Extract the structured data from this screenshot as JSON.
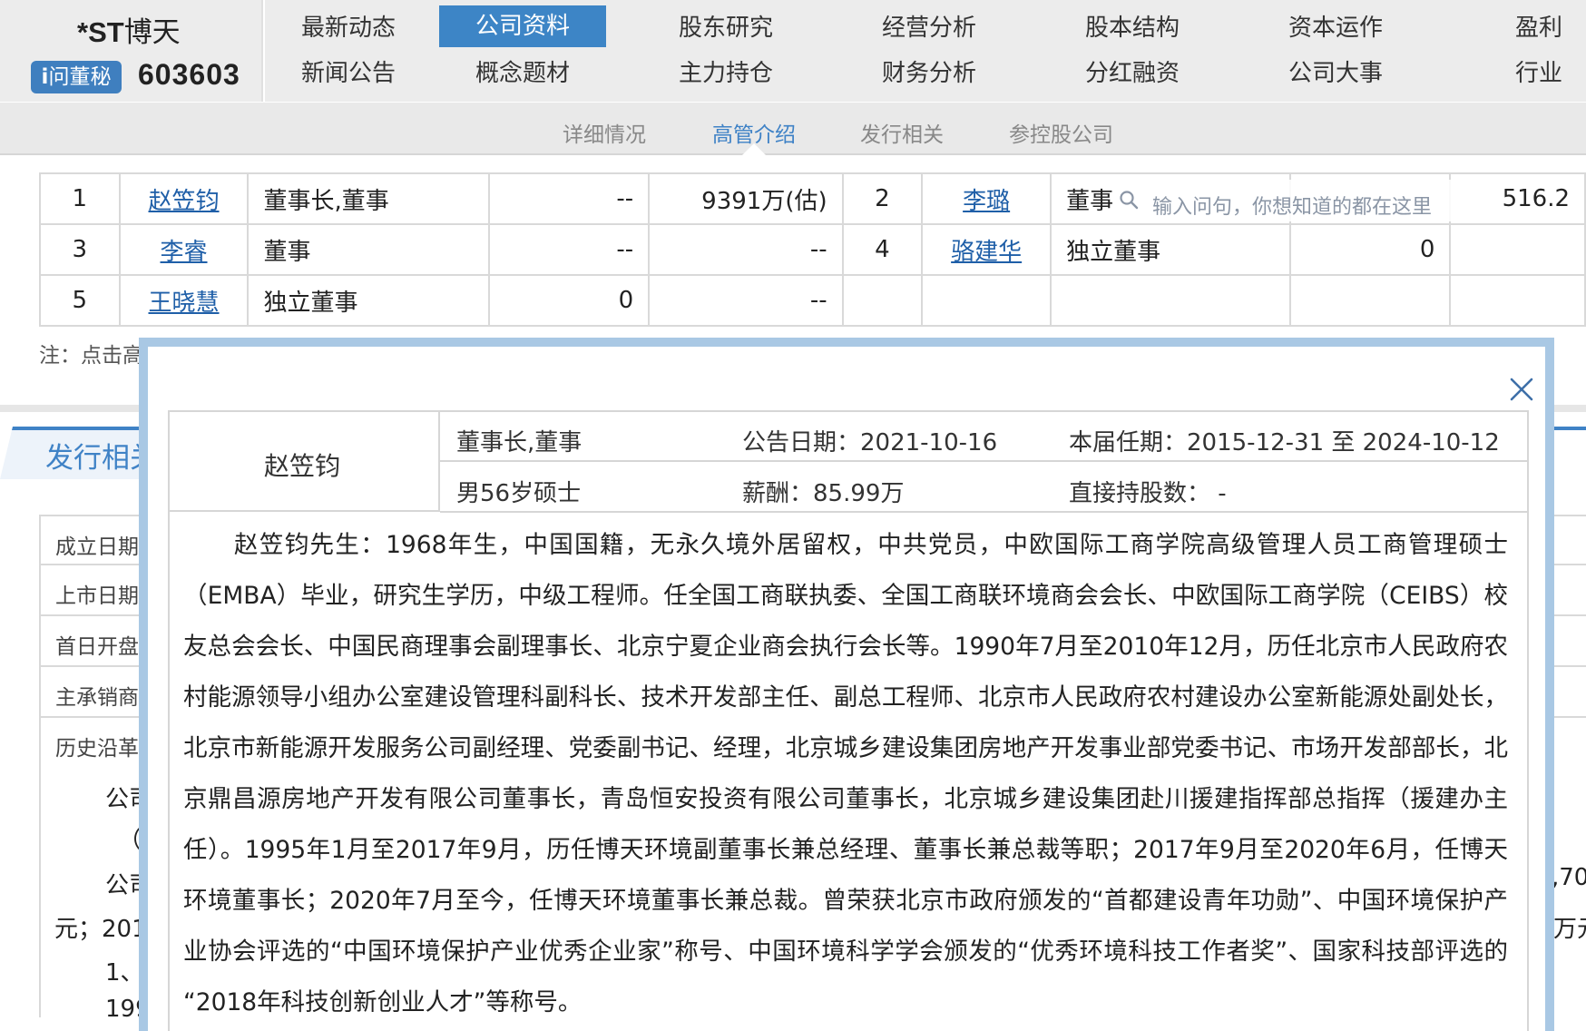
{
  "stock": {
    "prefix": "*ST",
    "name": "博天",
    "ask_label": "问董秘",
    "ask_prefix": "i",
    "code": "603603"
  },
  "nav": {
    "row1": [
      "最新动态",
      "公司资料",
      "股东研究",
      "经营分析",
      "股本结构",
      "资本运作",
      "盈利"
    ],
    "row2": [
      "新闻公告",
      "概念题材",
      "主力持仓",
      "财务分析",
      "分红融资",
      "公司大事",
      "行业"
    ],
    "active": "公司资料"
  },
  "subnav": {
    "items": [
      "详细情况",
      "高管介绍",
      "发行相关",
      "参控股公司"
    ],
    "active": "高管介绍"
  },
  "exec_table": {
    "rows": [
      {
        "n1": "1",
        "name1": "赵笠钧",
        "title1": "董事长,董事",
        "hold1": "--",
        "pay1": "9391万(估)",
        "n2": "2",
        "name2": "李璐",
        "title2": "董事",
        "hold2": "",
        "pay2": "516.2"
      },
      {
        "n1": "3",
        "name1": "李睿",
        "title1": "董事",
        "hold1": "--",
        "pay1": "--",
        "n2": "4",
        "name2": "骆建华",
        "title2": "独立董事",
        "hold2": "0",
        "pay2": ""
      },
      {
        "n1": "5",
        "name1": "王晓慧",
        "title1": "独立董事",
        "hold1": "0",
        "pay1": "--",
        "n2": "",
        "name2": "",
        "title2": "",
        "hold2": "",
        "pay2": ""
      }
    ]
  },
  "search": {
    "placeholder": "输入问句，你想知道的都在这里"
  },
  "note": "注：点击高",
  "section": {
    "title": "发行相关",
    "labels": [
      "成立日期",
      "上市日期",
      "首日开盘",
      "主承销商",
      "历史沿革"
    ],
    "fragments": {
      "f1": "公司",
      "f2": "（-",
      "f3": "公司",
      "f4": "元；201",
      "f5": "1、",
      "f6": "199"
    },
    "right_fragments": {
      "r1": ",70",
      "r2": "万元"
    }
  },
  "modal": {
    "close_icon": "close-icon",
    "name": "赵笠钧",
    "position": "董事长,董事",
    "announce_date_label": "公告日期：",
    "announce_date": "2021-10-16",
    "term_label": "本届任期：",
    "term": "2015-12-31 至 2024-10-12",
    "profile": "男56岁硕士",
    "salary_label": "薪酬：",
    "salary": "85.99万",
    "shares_label": "直接持股数：",
    "shares": "-",
    "bio": "赵笠钧先生：1968年生，中国国籍，无永久境外居留权，中共党员，中欧国际工商学院高级管理人员工商管理硕士（EMBA）毕业，研究生学历，中级工程师。任全国工商联执委、全国工商联环境商会会长、中欧国际工商学院（CEIBS）校友总会会长、中国民商理事会副理事长、北京宁夏企业商会执行会长等。1990年7月至2010年12月，历任北京市人民政府农村能源领导小组办公室建设管理科副科长、技术开发部主任、副总工程师、北京市人民政府农村建设办公室新能源处副处长，北京市新能源开发服务公司副经理、党委副书记、经理，北京城乡建设集团房地产开发事业部党委书记、市场开发部部长，北京鼎昌源房地产开发有限公司董事长，青岛恒安投资有限公司董事长，北京城乡建设集团赴川援建指挥部总指挥（援建办主任）。1995年1月至2017年9月，历任博天环境副董事长兼总经理、董事长兼总裁等职；2017年9月至2020年6月，任博天环境董事长；2020年7月至今，任博天环境董事长兼总裁。曾荣获北京市政府颁发的“首都建设青年功勋”、中国环境保护产业协会评选的“中国环境保护产业优秀企业家”称号、中国环境科学学会颁发的“优秀环境科技工作者奖”、国家科技部评选的“2018年科技创新创业人才”等称号。"
  },
  "colors": {
    "accent": "#3d85c6",
    "link": "#1f5fa8",
    "header_bg": "#ececec",
    "modal_border": "#a9c8e4"
  }
}
